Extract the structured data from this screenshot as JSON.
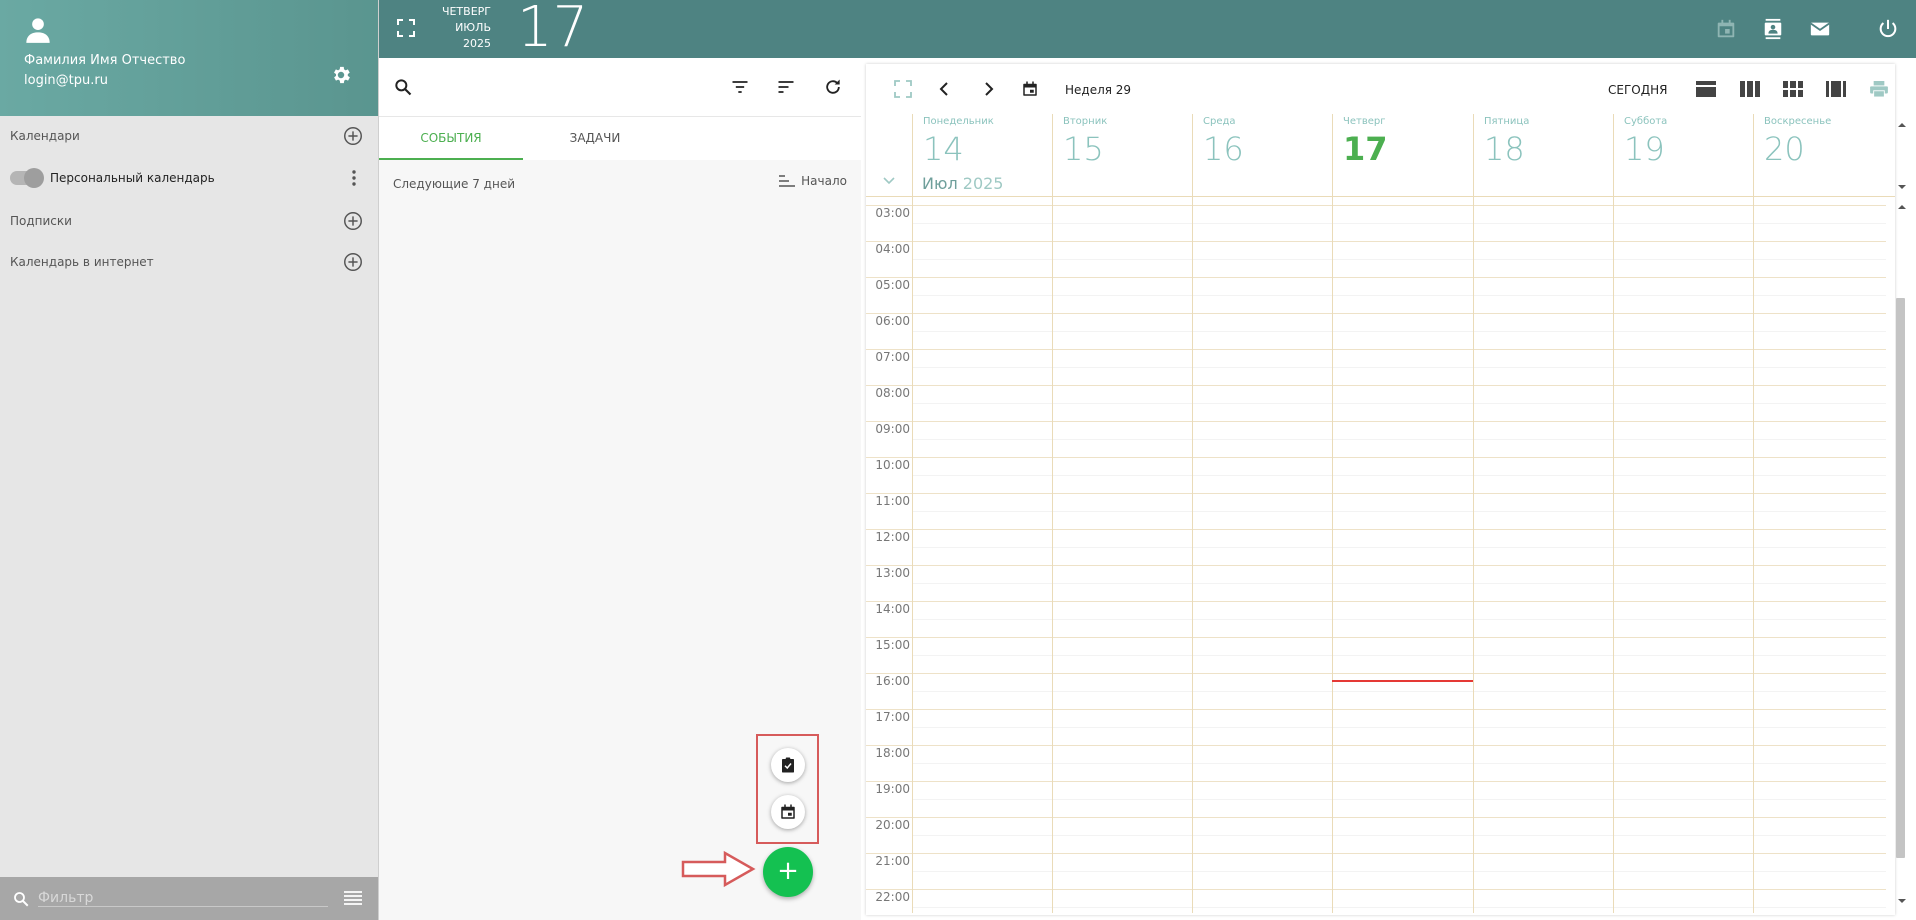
{
  "user": {
    "name": "Фамилия Имя Отчество",
    "login": "login@tpu.ru"
  },
  "sidebar": {
    "calendars_label": "Календари",
    "personal_calendar_label": "Персональный календарь",
    "subscriptions_label": "Подписки",
    "internet_calendar_label": "Календарь в интернет",
    "filter_placeholder": "Фильтр"
  },
  "header": {
    "weekday": "ЧЕТВЕРГ",
    "month": "ИЮЛЬ",
    "year": "2025",
    "day": "17"
  },
  "middle": {
    "tab_events": "СОБЫТИЯ",
    "tab_tasks": "ЗАДАЧИ",
    "next_days_label": "Следующие 7 дней",
    "sort_label": "Начало"
  },
  "calendar": {
    "week_label": "Неделя 29",
    "today_label": "СЕГОДНЯ",
    "month_label": "Июл",
    "year_label": "2025",
    "days": [
      {
        "name": "Понедельник",
        "num": "14"
      },
      {
        "name": "Вторник",
        "num": "15"
      },
      {
        "name": "Среда",
        "num": "16"
      },
      {
        "name": "Четверг",
        "num": "17"
      },
      {
        "name": "Пятница",
        "num": "18"
      },
      {
        "name": "Суббота",
        "num": "19"
      },
      {
        "name": "Воскресенье",
        "num": "20"
      }
    ],
    "hours": [
      "03:00",
      "04:00",
      "05:00",
      "06:00",
      "07:00",
      "08:00",
      "09:00",
      "10:00",
      "11:00",
      "12:00",
      "13:00",
      "14:00",
      "15:00",
      "16:00",
      "17:00",
      "18:00",
      "19:00",
      "20:00",
      "21:00",
      "22:00"
    ]
  },
  "colors": {
    "header": "#4e8382",
    "accent": "#4caf50",
    "fab": "#14c151",
    "highlight": "#d65b5b",
    "now_line": "#e53935"
  }
}
